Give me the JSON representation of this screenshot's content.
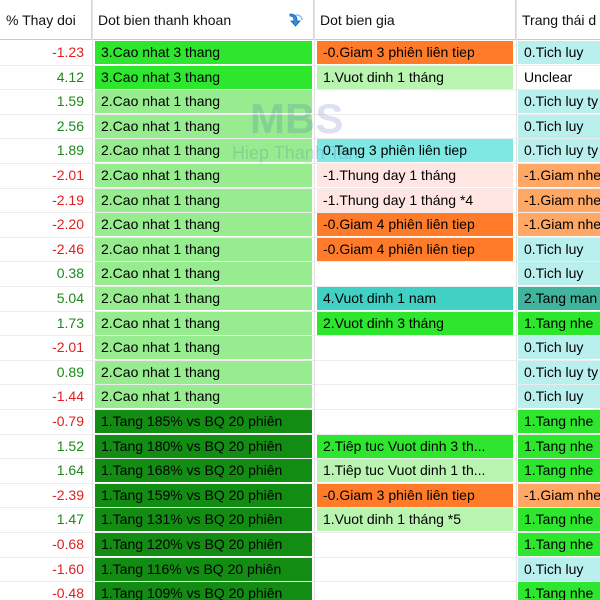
{
  "header": {
    "col_pct": "% Thay doi",
    "col_liquidity": "Dot bien thanh khoan",
    "col_price": "Dot bien gia",
    "col_state": "Trang thái d"
  },
  "watermark": {
    "logo": "MBS",
    "sub": "Hiep Thanh Tan"
  },
  "colors": {
    "liq_light": "#97ec8f",
    "liq_bright": "#2ee62e",
    "liq_dark": "#138c13",
    "price_orange": "#ff7b2a",
    "price_light_green": "#b9f5b0",
    "price_cyan": "#7fe8e2",
    "price_pink": "#ffe6e2",
    "price_teal": "#40d0c4",
    "price_green": "#2ee62e",
    "state_cyan": "#b9f0ee",
    "state_orange": "#ffa866",
    "state_green": "#2ee62e",
    "state_teal": "#40b49c"
  },
  "rows": [
    {
      "pct": "-1.23",
      "sign": "neg",
      "liq": "3.Cao nhat 3 thang",
      "liq_style": "liq_bright",
      "price": "-0.Giam 3 phiên liên tiep",
      "price_style": "price_orange",
      "state": "0.Tich luy",
      "state_style": "state_cyan"
    },
    {
      "pct": "4.12",
      "sign": "pos",
      "liq": "3.Cao nhat 3 thang",
      "liq_style": "liq_bright",
      "price": "1.Vuot dinh 1 tháng",
      "price_style": "price_light_green",
      "state": "Unclear",
      "state_style": "none"
    },
    {
      "pct": "1.59",
      "sign": "pos",
      "liq": "2.Cao nhat 1 thang",
      "liq_style": "liq_light",
      "price": "",
      "price_style": "none",
      "state": "0.Tich luy ty",
      "state_style": "state_cyan"
    },
    {
      "pct": "2.56",
      "sign": "pos",
      "liq": "2.Cao nhat 1 thang",
      "liq_style": "liq_light",
      "price": "",
      "price_style": "none",
      "state": "0.Tich luy",
      "state_style": "state_cyan"
    },
    {
      "pct": "1.89",
      "sign": "pos",
      "liq": "2.Cao nhat 1 thang",
      "liq_style": "liq_light",
      "price": "0.Tang 3 phiên liên tiep",
      "price_style": "price_cyan",
      "state": "0.Tich luy ty",
      "state_style": "state_cyan"
    },
    {
      "pct": "-2.01",
      "sign": "neg",
      "liq": "2.Cao nhat 1 thang",
      "liq_style": "liq_light",
      "price": "-1.Thung day 1 tháng",
      "price_style": "price_pink",
      "state": "-1.Giam nhe",
      "state_style": "state_orange"
    },
    {
      "pct": "-2.19",
      "sign": "neg",
      "liq": "2.Cao nhat 1 thang",
      "liq_style": "liq_light",
      "price": "-1.Thung day 1 tháng *4",
      "price_style": "price_pink",
      "state": "-1.Giam nhe",
      "state_style": "state_orange"
    },
    {
      "pct": "-2.20",
      "sign": "neg",
      "liq": "2.Cao nhat 1 thang",
      "liq_style": "liq_light",
      "price": "-0.Giam 4 phiên liên tiep",
      "price_style": "price_orange",
      "state": "-1.Giam nhe",
      "state_style": "state_orange"
    },
    {
      "pct": "-2.46",
      "sign": "neg",
      "liq": "2.Cao nhat 1 thang",
      "liq_style": "liq_light",
      "price": "-0.Giam 4 phiên liên tiep",
      "price_style": "price_orange",
      "state": "0.Tich luy",
      "state_style": "state_cyan"
    },
    {
      "pct": "0.38",
      "sign": "pos",
      "liq": "2.Cao nhat 1 thang",
      "liq_style": "liq_light",
      "price": "",
      "price_style": "none",
      "state": "0.Tich luy",
      "state_style": "state_cyan"
    },
    {
      "pct": "5.04",
      "sign": "pos",
      "liq": "2.Cao nhat 1 thang",
      "liq_style": "liq_light",
      "price": "4.Vuot dinh 1 nam",
      "price_style": "price_teal",
      "state": "2.Tang man",
      "state_style": "state_teal"
    },
    {
      "pct": "1.73",
      "sign": "pos",
      "liq": "2.Cao nhat 1 thang",
      "liq_style": "liq_light",
      "price": "2.Vuot dinh 3 tháng",
      "price_style": "price_green",
      "state": "1.Tang nhe",
      "state_style": "state_green"
    },
    {
      "pct": "-2.01",
      "sign": "neg",
      "liq": "2.Cao nhat 1 thang",
      "liq_style": "liq_light",
      "price": "",
      "price_style": "none",
      "state": "0.Tich luy",
      "state_style": "state_cyan"
    },
    {
      "pct": "0.89",
      "sign": "pos",
      "liq": "2.Cao nhat 1 thang",
      "liq_style": "liq_light",
      "price": "",
      "price_style": "none",
      "state": "0.Tich luy ty",
      "state_style": "state_cyan"
    },
    {
      "pct": "-1.44",
      "sign": "neg",
      "liq": "2.Cao nhat 1 thang",
      "liq_style": "liq_light",
      "price": "",
      "price_style": "none",
      "state": "0.Tich luy",
      "state_style": "state_cyan"
    },
    {
      "pct": "-0.79",
      "sign": "neg",
      "liq": "1.Tang 185% vs BQ 20 phiên",
      "liq_style": "liq_dark",
      "price": "",
      "price_style": "none",
      "state": "1.Tang nhe",
      "state_style": "state_green"
    },
    {
      "pct": "1.52",
      "sign": "pos",
      "liq": "1.Tang 180% vs BQ 20 phiên",
      "liq_style": "liq_dark",
      "price": "2.Tiêp tuc Vuot dinh 3 th...",
      "price_style": "price_green",
      "state": "1.Tang nhe",
      "state_style": "state_green"
    },
    {
      "pct": "1.64",
      "sign": "pos",
      "liq": "1.Tang 168% vs BQ 20 phiên",
      "liq_style": "liq_dark",
      "price": "1.Tiêp tuc Vuot dinh 1 th...",
      "price_style": "price_light_green",
      "state": "1.Tang nhe",
      "state_style": "state_green"
    },
    {
      "pct": "-2.39",
      "sign": "neg",
      "liq": "1.Tang 159% vs BQ 20 phiên",
      "liq_style": "liq_dark",
      "price": "-0.Giam 3 phiên liên tiep",
      "price_style": "price_orange",
      "state": "-1.Giam nhe",
      "state_style": "state_orange"
    },
    {
      "pct": "1.47",
      "sign": "pos",
      "liq": "1.Tang 131% vs BQ 20 phiên",
      "liq_style": "liq_dark",
      "price": "1.Vuot dinh 1 tháng *5",
      "price_style": "price_light_green",
      "state": "1.Tang nhe",
      "state_style": "state_green"
    },
    {
      "pct": "-0.68",
      "sign": "neg",
      "liq": "1.Tang 120% vs BQ 20 phiên",
      "liq_style": "liq_dark",
      "price": "",
      "price_style": "none",
      "state": "1.Tang nhe",
      "state_style": "state_green"
    },
    {
      "pct": "-1.60",
      "sign": "neg",
      "liq": "1.Tang 116% vs BQ 20 phiên",
      "liq_style": "liq_dark",
      "price": "",
      "price_style": "none",
      "state": "0.Tich luy",
      "state_style": "state_cyan"
    },
    {
      "pct": "-0.48",
      "sign": "neg",
      "liq": "1.Tang 109% vs BQ 20 phiên",
      "liq_style": "liq_dark",
      "price": "",
      "price_style": "none",
      "state": "1.Tang nhe",
      "state_style": "state_green"
    }
  ]
}
